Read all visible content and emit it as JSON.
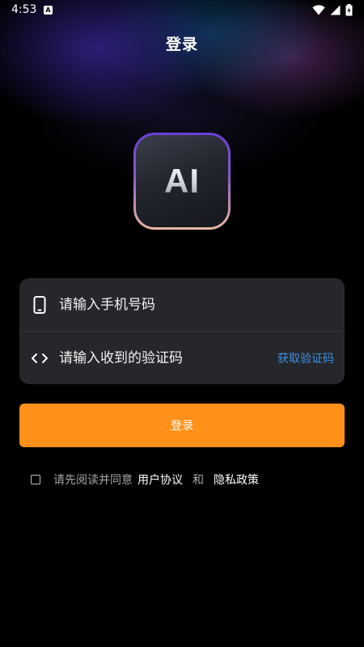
{
  "status_bar": {
    "time": "4:53",
    "notification_icon": "A",
    "icons": [
      "wifi-icon",
      "signal-icon",
      "battery-charging-icon"
    ]
  },
  "header": {
    "title": "登录"
  },
  "logo": {
    "text": "AI",
    "border_gradient": [
      "#6a3fd8",
      "#e9b9a0"
    ]
  },
  "form": {
    "phone": {
      "icon": "phone-icon",
      "value": "",
      "placeholder": "请输入手机号码"
    },
    "code": {
      "icon": "code-brackets-icon",
      "value": "",
      "placeholder": "请输入收到的验证码",
      "get_code_label": "获取验证码"
    }
  },
  "login_button": {
    "label": "登录",
    "color": "#ff911a"
  },
  "agreement": {
    "checked": false,
    "prefix": "请先阅读并同意",
    "user_agreement": "用户协议",
    "and": "和",
    "privacy_policy": "隐私政策"
  },
  "colors": {
    "link_blue": "#3c8fe2",
    "card_bg": "#26272b",
    "background": "#000000"
  }
}
